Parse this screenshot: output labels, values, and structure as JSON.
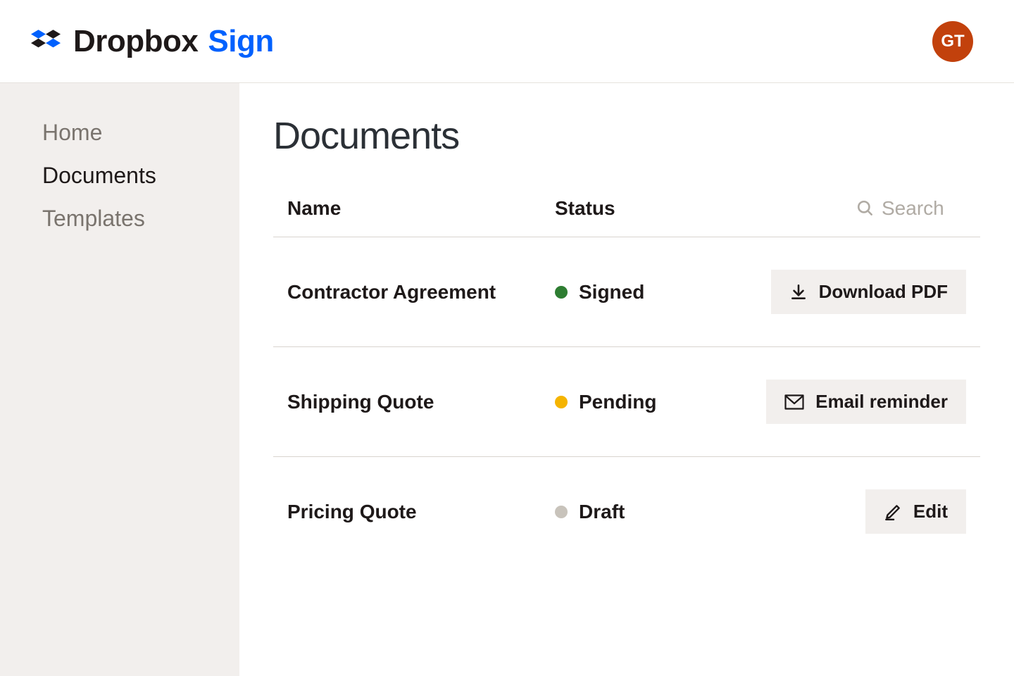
{
  "header": {
    "brand_primary": "Dropbox",
    "brand_secondary": "Sign",
    "avatar_initials": "GT"
  },
  "sidebar": {
    "items": [
      {
        "label": "Home",
        "active": false
      },
      {
        "label": "Documents",
        "active": true
      },
      {
        "label": "Templates",
        "active": false
      }
    ]
  },
  "main": {
    "title": "Documents",
    "columns": {
      "name": "Name",
      "status": "Status"
    },
    "search_placeholder": "Search",
    "rows": [
      {
        "name": "Contractor Agreement",
        "status": "Signed",
        "status_kind": "signed",
        "action_label": "Download PDF",
        "action_icon": "download"
      },
      {
        "name": "Shipping Quote",
        "status": "Pending",
        "status_kind": "pending",
        "action_label": "Email reminder",
        "action_icon": "mail"
      },
      {
        "name": "Pricing Quote",
        "status": "Draft",
        "status_kind": "draft",
        "action_label": "Edit",
        "action_icon": "edit"
      }
    ]
  },
  "colors": {
    "accent": "#0061fe",
    "avatar_bg": "#c2410c",
    "signed": "#2e7d32",
    "pending": "#f5b400",
    "draft": "#c8c3bb"
  }
}
